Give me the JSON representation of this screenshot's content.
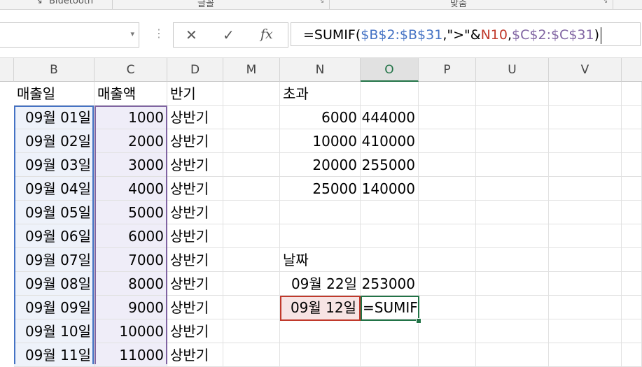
{
  "ribbon": {
    "group_left": "Bluetooth",
    "group_mid": "글꼴",
    "group_right": "맞춤"
  },
  "formula_bar": {
    "cancel_icon": "✕",
    "enter_icon": "✓",
    "fx_label": "fx",
    "formula_parts": [
      {
        "text": "=SUMIF(",
        "color": "#000000"
      },
      {
        "text": "$B$2:$B$31",
        "color": "#4472c4"
      },
      {
        "text": ",\">\"&",
        "color": "#000000"
      },
      {
        "text": "N10",
        "color": "#c0392b"
      },
      {
        "text": ",",
        "color": "#000000"
      },
      {
        "text": "$C$2:$C$31",
        "color": "#8064a2"
      },
      {
        "text": ")",
        "color": "#000000"
      }
    ]
  },
  "columns": [
    "B",
    "C",
    "D",
    "M",
    "N",
    "O",
    "P",
    "U",
    "V"
  ],
  "selected_column": "O",
  "headers": {
    "b": "매출일",
    "c": "매출액",
    "d": "반기"
  },
  "rows": [
    {
      "date": "09월 01일",
      "amount": "1000",
      "half": "상반기"
    },
    {
      "date": "09월 02일",
      "amount": "2000",
      "half": "상반기"
    },
    {
      "date": "09월 03일",
      "amount": "3000",
      "half": "상반기"
    },
    {
      "date": "09월 04일",
      "amount": "4000",
      "half": "상반기"
    },
    {
      "date": "09월 05일",
      "amount": "5000",
      "half": "상반기"
    },
    {
      "date": "09월 06일",
      "amount": "6000",
      "half": "상반기"
    },
    {
      "date": "09월 07일",
      "amount": "7000",
      "half": "상반기"
    },
    {
      "date": "09월 08일",
      "amount": "8000",
      "half": "상반기"
    },
    {
      "date": "09월 09일",
      "amount": "9000",
      "half": "상반기"
    },
    {
      "date": "09월 10일",
      "amount": "10000",
      "half": "상반기"
    },
    {
      "date": "09월 11일",
      "amount": "11000",
      "half": "상반기"
    }
  ],
  "excess_section": {
    "label": "초과",
    "rows": [
      {
        "threshold": "6000",
        "sum": "444000"
      },
      {
        "threshold": "10000",
        "sum": "410000"
      },
      {
        "threshold": "20000",
        "sum": "255000"
      },
      {
        "threshold": "25000",
        "sum": "140000"
      }
    ]
  },
  "date_section": {
    "label": "날짜",
    "row1_date": "09월 22일",
    "row1_sum": "253000",
    "row2_date": "09월 12일",
    "row2_editing": "=SUMIF"
  }
}
